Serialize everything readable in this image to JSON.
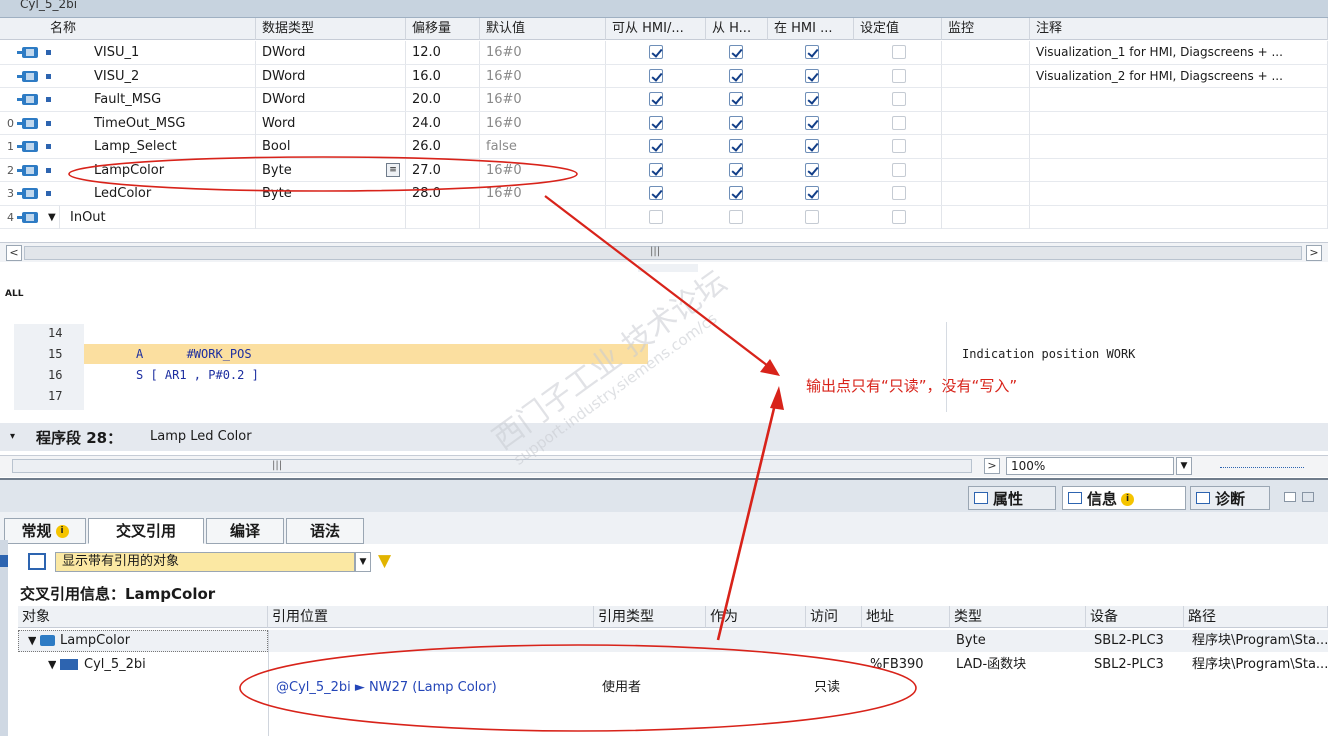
{
  "block_title": "Cyl_5_2bi",
  "interface_table": {
    "headers": [
      "名称",
      "数据类型",
      "偏移量",
      "默认值",
      "可从 HMI/...",
      "从 H...",
      "在 HMI ...",
      "设定值",
      "监控",
      "注释"
    ],
    "rows": [
      {
        "num": "",
        "name": "VISU_1",
        "type": "DWord",
        "offset": "12.0",
        "default": "16#0",
        "hmi1": true,
        "hmi2": true,
        "hmi3": true,
        "setpoint": false,
        "comment": "Visualization_1 for HMI, Diagscreens + ..."
      },
      {
        "num": "",
        "name": "VISU_2",
        "type": "DWord",
        "offset": "16.0",
        "default": "16#0",
        "hmi1": true,
        "hmi2": true,
        "hmi3": true,
        "setpoint": false,
        "comment": "Visualization_2 for HMI, Diagscreens + ..."
      },
      {
        "num": "",
        "name": "Fault_MSG",
        "type": "DWord",
        "offset": "20.0",
        "default": "16#0",
        "hmi1": true,
        "hmi2": true,
        "hmi3": true,
        "setpoint": false,
        "comment": ""
      },
      {
        "num": "0",
        "name": "TimeOut_MSG",
        "type": "Word",
        "offset": "24.0",
        "default": "16#0",
        "hmi1": true,
        "hmi2": true,
        "hmi3": true,
        "setpoint": false,
        "comment": ""
      },
      {
        "num": "1",
        "name": "Lamp_Select",
        "type": "Bool",
        "offset": "26.0",
        "default": "false",
        "hmi1": true,
        "hmi2": true,
        "hmi3": true,
        "setpoint": false,
        "comment": ""
      },
      {
        "num": "2",
        "name": "LampColor",
        "type": "Byte",
        "offset": "27.0",
        "default": "16#0",
        "hmi1": true,
        "hmi2": true,
        "hmi3": true,
        "setpoint": false,
        "comment": ""
      },
      {
        "num": "3",
        "name": "LedColor",
        "type": "Byte",
        "offset": "28.0",
        "default": "16#0",
        "hmi1": true,
        "hmi2": true,
        "hmi3": true,
        "setpoint": false,
        "comment": ""
      },
      {
        "num": "4",
        "name": "InOut",
        "type": "",
        "offset": "",
        "default": "",
        "hmi1": false,
        "hmi2": false,
        "hmi3": false,
        "setpoint": false,
        "comment": ""
      }
    ]
  },
  "code": {
    "all_label": "ALL",
    "lines": [
      {
        "num": "14",
        "text": ""
      },
      {
        "num": "15",
        "text": "A      #WORK_POS"
      },
      {
        "num": "16",
        "text": "S [ AR1 , P#0.2 ]"
      },
      {
        "num": "17",
        "text": ""
      }
    ],
    "comment": "Indication position WORK"
  },
  "network": {
    "title": "程序段 28：",
    "subtitle": "Lamp Led Color"
  },
  "zoom": "100%",
  "inspector_tabs": [
    {
      "label": "属性",
      "active": false
    },
    {
      "label": "信息",
      "active": true
    },
    {
      "label": "诊断",
      "active": false
    }
  ],
  "sub_tabs": [
    {
      "label": "常规",
      "active": false
    },
    {
      "label": "交叉引用",
      "active": true
    },
    {
      "label": "编译",
      "active": false
    },
    {
      "label": "语法",
      "active": false
    }
  ],
  "filter": {
    "value": "显示带有引用的对象"
  },
  "cross_ref": {
    "title": "交叉引用信息：LampColor",
    "headers": [
      "对象",
      "引用位置",
      "引用类型",
      "作为",
      "访问",
      "地址",
      "类型",
      "设备",
      "路径"
    ],
    "rows": [
      {
        "object": "LampColor",
        "location": "",
        "reftype": "",
        "as": "",
        "access": "",
        "address": "",
        "type": "Byte",
        "device": "SBL2-PLC3",
        "path": "程序块\\Program\\Sta..."
      },
      {
        "object": "Cyl_5_2bi",
        "location": "",
        "reftype": "",
        "as": "",
        "access": "",
        "address": "%FB390",
        "type": "LAD-函数块",
        "device": "SBL2-PLC3",
        "path": "程序块\\Program\\Sta..."
      },
      {
        "object": "",
        "location": "@Cyl_5_2bi ► NW27 (Lamp Color)",
        "reftype": "使用者",
        "as": "",
        "access": "只读",
        "address": "",
        "type": "",
        "device": "",
        "path": ""
      }
    ]
  },
  "annotation": "输出点只有“只读”，没有“写入”",
  "watermark": {
    "line1": "西门子工业 技术论坛",
    "line2": "support.industry.siemens.com/cs"
  },
  "colors": {
    "annotation_red": "#d8231a",
    "highlight": "#fbdfa0",
    "filter_bg": "#fbe8a3"
  }
}
